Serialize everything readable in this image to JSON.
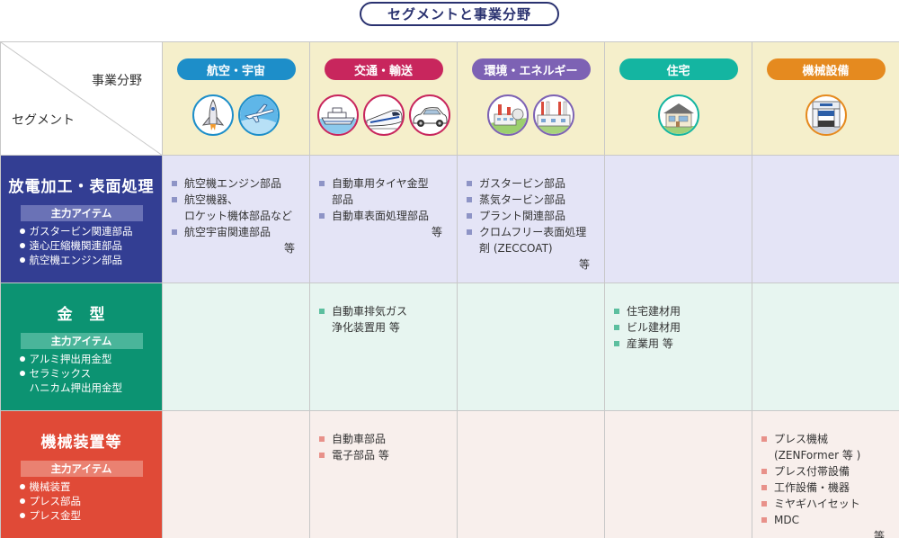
{
  "title": "セグメントと事業分野",
  "corner": {
    "field_label": "事業分野",
    "segment_label": "セグメント"
  },
  "fields": [
    {
      "label": "航空・宇宙",
      "color": "#1d8ec9",
      "icons": [
        "space-shuttle-icon",
        "airplane-icon"
      ]
    },
    {
      "label": "交通・輸送",
      "color": "#c8265d",
      "icons": [
        "ship-icon",
        "bullet-train-icon",
        "car-icon"
      ]
    },
    {
      "label": "環境・エネルギー",
      "color": "#7d62b4",
      "icons": [
        "power-plant-icon",
        "factory-icon"
      ]
    },
    {
      "label": "住宅",
      "color": "#14b5a1",
      "icons": [
        "house-icon"
      ]
    },
    {
      "label": "機械設備",
      "color": "#e58a1f",
      "icons": [
        "press-machine-icon"
      ]
    }
  ],
  "segments": [
    {
      "name": "放電加工・表面処理",
      "color": "#333e93",
      "sub_color": "#6a72b6",
      "marker": "#8e94c6",
      "sub_label": "主力アイテム",
      "items": [
        "ガスタービン関連部品",
        "遠心圧縮機関連部品",
        "航空機エンジン部品"
      ],
      "cells": [
        {
          "items": [
            "航空機エンジン部品",
            "航空機器、\nロケット機体部品など",
            "航空宇宙関連部品"
          ],
          "trail": "等"
        },
        {
          "items": [
            "自動車用タイヤ金型\n部品",
            "自動車表面処理部品"
          ],
          "trail": "等"
        },
        {
          "items": [
            "ガスタービン部品",
            "蒸気タービン部品",
            "プラント関連部品",
            "クロムフリー表面処理\n剤 (ZECCOAT)"
          ],
          "trail": "等"
        },
        {
          "items": [],
          "trail": ""
        },
        {
          "items": [],
          "trail": ""
        }
      ]
    },
    {
      "name": "金　型",
      "color": "#0c9372",
      "sub_color": "#4ab59a",
      "marker": "#5cbf9f",
      "sub_label": "主力アイテム",
      "items": [
        "アルミ押出用金型",
        "セラミックス\nハニカム押出用金型"
      ],
      "cells": [
        {
          "items": [],
          "trail": ""
        },
        {
          "items": [
            "自動車排気ガス\n浄化装置用 等"
          ],
          "trail": ""
        },
        {
          "items": [],
          "trail": ""
        },
        {
          "items": [
            "住宅建材用",
            "ビル建材用",
            "産業用 等"
          ],
          "trail": ""
        },
        {
          "items": [],
          "trail": ""
        }
      ]
    },
    {
      "name": "機械装置等",
      "color": "#e04a37",
      "sub_color": "#ea8171",
      "marker": "#e8918a",
      "sub_label": "主力アイテム",
      "items": [
        "機械装置",
        "プレス部品",
        "プレス金型"
      ],
      "cells": [
        {
          "items": [],
          "trail": ""
        },
        {
          "items": [
            "自動車部品",
            "電子部品 等"
          ],
          "trail": ""
        },
        {
          "items": [],
          "trail": ""
        },
        {
          "items": [],
          "trail": ""
        },
        {
          "items": [
            "プレス機械\n(ZENFormer 等 )",
            "プレス付帯設備",
            "工作設備・機器",
            "ミヤギハイセット",
            "MDC"
          ],
          "trail": "等"
        }
      ]
    }
  ]
}
